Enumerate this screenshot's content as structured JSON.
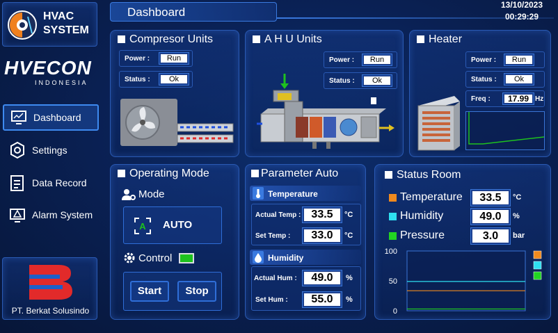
{
  "logo": {
    "title_line1": "HVAC",
    "title_line2": "SYSTEM"
  },
  "brand": {
    "name": "HVECON",
    "sub": "INDONESIA"
  },
  "nav": [
    {
      "label": "Dashboard",
      "icon": "dashboard-icon",
      "active": true
    },
    {
      "label": "Settings",
      "icon": "settings-icon"
    },
    {
      "label": "Data Record",
      "icon": "data-record-icon"
    },
    {
      "label": "Alarm System",
      "icon": "alarm-icon"
    }
  ],
  "company": {
    "name": "PT. Berkat Solusindo"
  },
  "header": {
    "title": "Dashboard",
    "date": "13/10/2023",
    "time": "00:29:29"
  },
  "compressor": {
    "title": "Compresor Units",
    "power_label": "Power :",
    "power_value": "Run",
    "status_label": "Status :",
    "status_value": "Ok"
  },
  "ahu": {
    "title": "A H U Units",
    "power_label": "Power :",
    "power_value": "Run",
    "status_label": "Status :",
    "status_value": "Ok"
  },
  "heater": {
    "title": "Heater",
    "power_label": "Power :",
    "power_value": "Run",
    "status_label": "Status :",
    "status_value": "Ok",
    "freq_label": "Freq :",
    "freq_value": "17.99",
    "freq_unit": "Hz"
  },
  "operating": {
    "title": "Operating Mode",
    "mode_label": "Mode",
    "mode_value": "AUTO",
    "control_label": "Control",
    "start": "Start",
    "stop": "Stop",
    "control_color": "#1ec21e"
  },
  "param": {
    "title": "Parameter Auto",
    "temp_section": "Temperature",
    "actual_temp_label": "Actual Temp :",
    "actual_temp_value": "33.5",
    "actual_temp_unit": "°C",
    "set_temp_label": "Set Temp :",
    "set_temp_value": "33.0",
    "set_temp_unit": "°C",
    "hum_section": "Humidity",
    "actual_hum_label": "Actual Hum :",
    "actual_hum_value": "49.0",
    "actual_hum_unit": "%",
    "set_hum_label": "Set Hum :",
    "set_hum_value": "55.0",
    "set_hum_unit": "%"
  },
  "status_room": {
    "title": "Status Room",
    "rows": [
      {
        "label": "Temperature",
        "value": "33.5",
        "unit": "°C",
        "color": "#f08a1e"
      },
      {
        "label": "Humidity",
        "value": "49.0",
        "unit": "%",
        "color": "#2ee0f0"
      },
      {
        "label": "Pressure",
        "value": "3.0",
        "unit": "bar",
        "color": "#22d422"
      }
    ]
  },
  "chart_data": {
    "type": "line",
    "ylim": [
      0,
      100
    ],
    "yticks": [
      "100",
      "50",
      "0"
    ],
    "series": [
      {
        "values": [
          33.5,
          33.5
        ],
        "color": "#f08a1e"
      },
      {
        "values": [
          49.0,
          49.0
        ],
        "color": "#2ee0f0"
      },
      {
        "values": [
          3.0,
          3.0
        ],
        "color": "#22d422"
      }
    ]
  }
}
